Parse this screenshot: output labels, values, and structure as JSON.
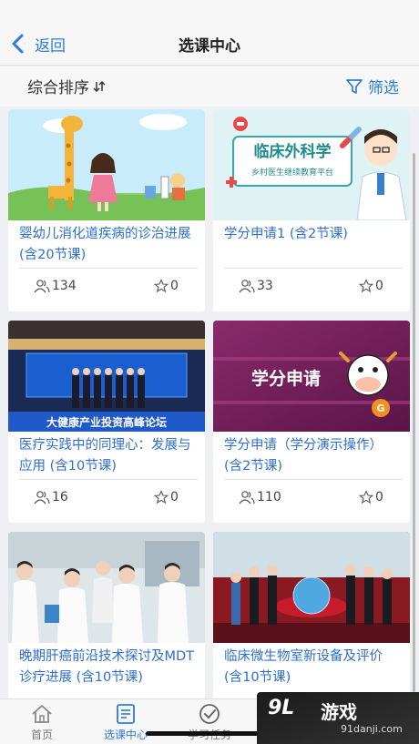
{
  "header": {
    "back_label": "返回",
    "title": "选课中心"
  },
  "sortbar": {
    "sort_label": "综合排序",
    "filter_label": "筛选"
  },
  "courses": [
    {
      "title": "婴幼儿消化道疾病的诊治进展 (含20节课)",
      "students": "134",
      "favorites": "0",
      "thumb_text": ""
    },
    {
      "title": "学分申请1 (含2节课)",
      "students": "33",
      "favorites": "0",
      "thumb_text": "临床外科学",
      "thumb_sub": "乡村医生继续教育平台"
    },
    {
      "title": "医疗实践中的同理心：发展与应用 (含10节课)",
      "students": "16",
      "favorites": "0",
      "thumb_text": "大健康产业投资高峰论坛"
    },
    {
      "title": "学分申请（学分演示操作） (含2节课)",
      "students": "110",
      "favorites": "0",
      "thumb_text": "学分申请"
    },
    {
      "title": "晚期肝癌前沿技术探讨及MDT诊疗进展 (含10节课)",
      "students": "",
      "favorites": "",
      "thumb_text": ""
    },
    {
      "title": "临床微生物室新设备及评价 (含10节课)",
      "students": "",
      "favorites": "",
      "thumb_text": ""
    }
  ],
  "tabs": [
    {
      "label": "首页",
      "icon": "home-icon",
      "active": false
    },
    {
      "label": "选课中心",
      "icon": "course-list-icon",
      "active": true
    },
    {
      "label": "学习任务",
      "icon": "check-circle-icon",
      "active": false
    }
  ],
  "watermark": {
    "brand": "游戏",
    "logo": "9L",
    "url": "91danji.com"
  },
  "colors": {
    "accent": "#2d7ae0",
    "title_link": "#2d6fd0",
    "background": "#eef0f3"
  }
}
